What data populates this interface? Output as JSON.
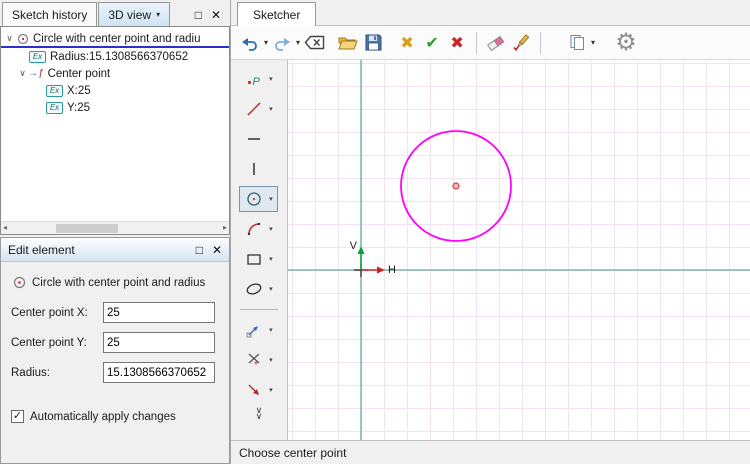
{
  "glyphs": {
    "dropdown": "▾",
    "maximize": "□",
    "close": "✕",
    "expander": "∨",
    "ref_arrow": "→",
    "ref_f": "ƒ",
    "delete_cross": "✖",
    "apply_check": "✔",
    "cancel_cross": "✖",
    "gear": "⚙",
    "more_chevron": "∨",
    "checkbox_check": "✓",
    "scroll_left": "◂",
    "scroll_right": "▸"
  },
  "left_panel": {
    "tabs": [
      {
        "label": "Sketch history",
        "active": true
      },
      {
        "label": "3D view",
        "active": false
      }
    ],
    "ex_badge": "Ex",
    "tree": [
      {
        "label": "Circle with center point and radiu",
        "level": 0,
        "icon": "circle-element-icon",
        "selected": true
      },
      {
        "label": "Radius:15.1308566370652",
        "level": 1,
        "icon": "expression-icon"
      },
      {
        "label": "Center point",
        "level": 1,
        "icon": "reference-icon"
      },
      {
        "label": "X:25",
        "level": 2,
        "icon": "expression-icon"
      },
      {
        "label": "Y:25",
        "level": 2,
        "icon": "expression-icon"
      }
    ]
  },
  "edit_panel": {
    "title": "Edit element",
    "element_type": "Circle with center point and radius",
    "fields": [
      {
        "label": "Center point X:",
        "value": "25"
      },
      {
        "label": "Center point Y:",
        "value": "25"
      },
      {
        "label": "Radius:",
        "value": "15.1308566370652"
      }
    ],
    "auto_apply": {
      "label": "Automatically apply changes",
      "checked": true
    }
  },
  "sketcher": {
    "tab_label": "Sketcher",
    "status_text": "Choose center point",
    "toolbar_icons": [
      "undo",
      "redo",
      "backspace",
      "open-folder",
      "save",
      "delete",
      "apply",
      "cancel",
      "eraser",
      "edit-style",
      "pages",
      "settings-gear"
    ],
    "tool_icons": [
      "point",
      "line",
      "horizontal-line",
      "vertical-line",
      "circle",
      "arc",
      "rectangle",
      "ellipse",
      "transform",
      "trim",
      "offset",
      "more-tools"
    ],
    "selected_tool": "circle",
    "canvas": {
      "v_axis_label": "V",
      "h_axis_label": "H",
      "circle": {
        "center_x": "25",
        "center_y": "25",
        "radius": "15.1308566370652"
      }
    }
  },
  "colors": {
    "circle_stroke": "#ff00ff",
    "center_point": "#cc4444",
    "center_point_fill": "#f2b8b8",
    "axis": "#3a997e",
    "grid_line": "#f2e2f2",
    "v_arrow": "#00a33e",
    "h_arrow": "#cc2222",
    "selection_underline": "#2d2dd0"
  }
}
